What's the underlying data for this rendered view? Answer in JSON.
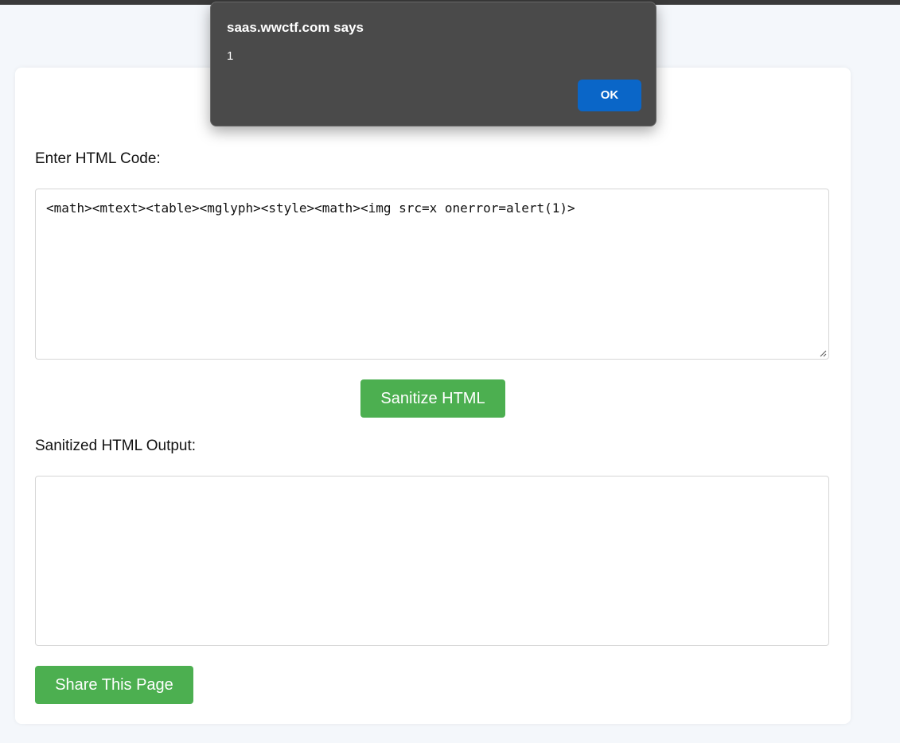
{
  "dialog": {
    "title": "saas.wwctf.com says",
    "message": "1",
    "ok_label": "OK"
  },
  "form": {
    "input_label": "Enter HTML Code:",
    "input_value": "<math><mtext><table><mglyph><style><math><img src=x onerror=alert(1)>",
    "sanitize_label": "Sanitize HTML",
    "output_label": "Sanitized HTML Output:",
    "output_value": "",
    "share_label": "Share This Page"
  },
  "colors": {
    "button_green": "#4caf50",
    "dialog_ok_blue": "#0a66c8",
    "dialog_bg": "#4a4a4a"
  }
}
